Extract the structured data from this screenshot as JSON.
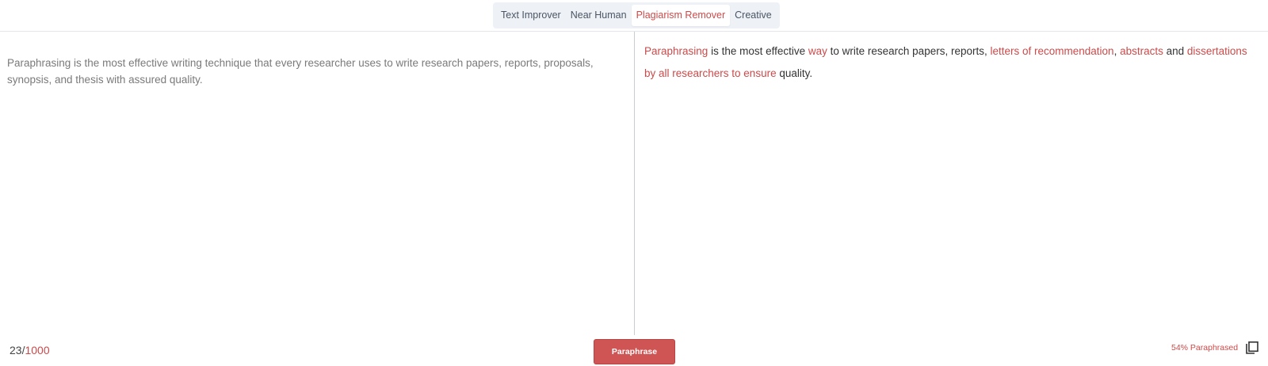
{
  "tabs": [
    {
      "label": "Text Improver"
    },
    {
      "label": "Near Human"
    },
    {
      "label": "Plagiarism Remover"
    },
    {
      "label": "Creative"
    }
  ],
  "active_tab": "Plagiarism Remover",
  "input": {
    "text": "Paraphrasing is the most effective writing technique that every researcher uses to write research papers, reports, proposals, synopsis, and thesis with assured quality."
  },
  "output": {
    "segments": [
      {
        "text": "Paraphrasing",
        "changed": true
      },
      {
        "text": " is the most effective ",
        "changed": false
      },
      {
        "text": "way",
        "changed": true
      },
      {
        "text": " to write research papers, reports, ",
        "changed": false
      },
      {
        "text": "letters of recommendation",
        "changed": true
      },
      {
        "text": ", ",
        "changed": false
      },
      {
        "text": "abstracts",
        "changed": true
      },
      {
        "text": " and ",
        "changed": false
      },
      {
        "text": "dissertations by all researchers to ensure",
        "changed": true
      },
      {
        "text": " quality.",
        "changed": false
      }
    ]
  },
  "counter": {
    "current": "23/",
    "max": "1000"
  },
  "paraphrase_button": {
    "label": "Paraphrase"
  },
  "status": {
    "text": "54% Paraphrased"
  },
  "icons": {
    "copy": "copy-icon"
  },
  "colors": {
    "accent": "#cc4a4a",
    "button": "#cf5454",
    "tab_bg": "#eef2f7"
  }
}
